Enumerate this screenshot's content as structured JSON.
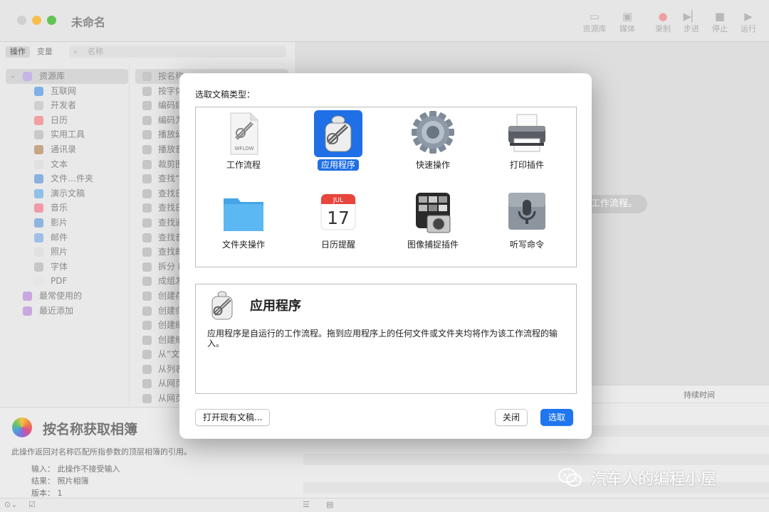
{
  "window": {
    "title": "未命名",
    "toolbar": [
      {
        "label": "资源库",
        "icon": "library-icon"
      },
      {
        "label": "媒体",
        "icon": "media-icon"
      },
      {
        "label": "录制",
        "icon": "record-icon"
      },
      {
        "label": "步进",
        "icon": "step-icon"
      },
      {
        "label": "停止",
        "icon": "stop-icon"
      },
      {
        "label": "运行",
        "icon": "run-icon"
      }
    ]
  },
  "sidebar": {
    "tabs": [
      "操作",
      "变量"
    ],
    "search_placeholder": "名称",
    "library": [
      "资源库",
      "互联网",
      "开发者",
      "日历",
      "实用工具",
      "通讯录",
      "文本",
      "文件…件夹",
      "演示文稿",
      "音乐",
      "影片",
      "邮件",
      "照片",
      "字体",
      "PDF",
      "最常使用的",
      "最近添加"
    ],
    "actions": [
      "按名称",
      "按字体",
      "编码媒",
      "编码为",
      "播放幻",
      "播放音",
      "裁剪图",
      "查找“",
      "查找日",
      "查找日",
      "查找通",
      "查找音",
      "查找邮",
      "拆分 P",
      "成组发",
      "创建存",
      "创建归",
      "创建缩",
      "创建缩",
      "从“文",
      "从列表",
      "从网页",
      "从网页"
    ]
  },
  "description": {
    "title": "按名称获取相簿",
    "text": "此操作返回对名称匹配所指参数的顶层相簿的引用。",
    "input": "输入： 此操作不接受输入",
    "result": "结果： 照片相簿",
    "version": "版本： 1"
  },
  "workflow_hint": "工作流程。",
  "log": {
    "duration_header": "持续时间"
  },
  "watermark": "汽车人的编程小屋",
  "sheet": {
    "label": "选取文稿类型：",
    "types": [
      {
        "label": "工作流程",
        "icon": "workflow-document-icon",
        "badge": "WFLOW",
        "selected": false
      },
      {
        "label": "应用程序",
        "icon": "automator-robot-icon",
        "selected": true
      },
      {
        "label": "快速操作",
        "icon": "gear-icon",
        "selected": false
      },
      {
        "label": "打印插件",
        "icon": "printer-icon",
        "selected": false
      },
      {
        "label": "文件夹操作",
        "icon": "folder-icon",
        "selected": false
      },
      {
        "label": "日历提醒",
        "icon": "calendar-icon",
        "month": "JUL",
        "day": "17",
        "selected": false
      },
      {
        "label": "图像捕捉插件",
        "icon": "image-capture-icon",
        "selected": false
      },
      {
        "label": "听写命令",
        "icon": "microphone-icon",
        "selected": false
      }
    ],
    "info_title": "应用程序",
    "info_desc": "应用程序是自运行的工作流程。拖到应用程序上的任何文件或文件夹均将作为该工作流程的输入。",
    "buttons": {
      "open_existing": "打开现有文稿...",
      "close": "关闭",
      "choose": "选取"
    }
  }
}
